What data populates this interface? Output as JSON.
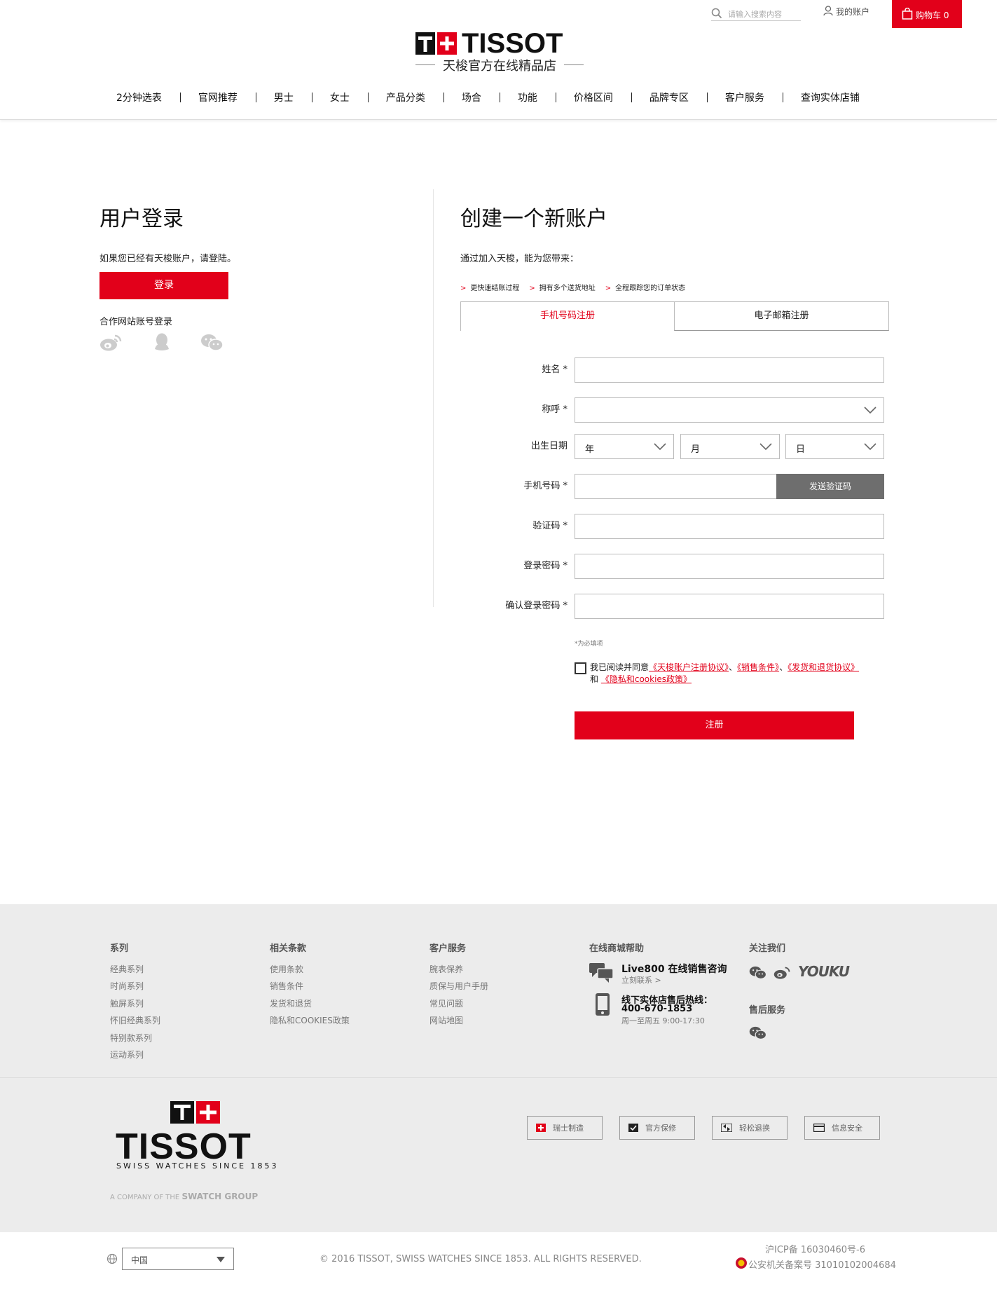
{
  "header": {
    "search_placeholder": "请输入搜索内容",
    "account_label": "我的账户",
    "cart_label": "购物车 0",
    "logo_word": "TISSOT",
    "logo_sub": "天梭官方在线精品店",
    "nav": [
      "2分钟选表",
      "官网推荐",
      "男士",
      "女士",
      "产品分类",
      "场合",
      "功能",
      "价格区间",
      "品牌专区",
      "客户服务",
      "查询实体店铺"
    ]
  },
  "login": {
    "title": "用户登录",
    "desc": "如果您已经有天梭账户，请登陆。",
    "button": "登录",
    "partner_label": "合作网站账号登录",
    "partners": [
      "weibo-icon",
      "qq-icon",
      "wechat-icon"
    ]
  },
  "register": {
    "title": "创建一个新账户",
    "desc": "通过加入天梭，能为您带来：",
    "benefits": [
      "更快速结账过程",
      "拥有多个送货地址",
      "全程跟踪您的订单状态"
    ],
    "tab_phone": "手机号码注册",
    "tab_email": "电子邮箱注册",
    "labels": {
      "name": "姓名 *",
      "salutation": "称呼 *",
      "birthday": "出生日期",
      "phone": "手机号码 *",
      "code": "验证码 *",
      "password": "登录密码 *",
      "confirm": "确认登录密码 *"
    },
    "year": "年",
    "month": "月",
    "day": "日",
    "send_code": "发送验证码",
    "required_note": "*为必填项",
    "agree_prefix": "我已阅读并同意",
    "agree_link1": "《天梭账户注册协议》",
    "agree_link2": "《销售条件》",
    "agree_link3": "《发货和退货协议》",
    "agree_and": "和",
    "agree_link4": "《隐私和cookies政策》",
    "sep": "、",
    "submit": "注册"
  },
  "footer": {
    "col1": {
      "title": "系列",
      "links": [
        "经典系列",
        "时尚系列",
        "触屏系列",
        "怀旧经典系列",
        "特别款系列",
        "运动系列"
      ]
    },
    "col2": {
      "title": "相关条款",
      "links": [
        "使用条款",
        "销售条件",
        "发货和退货",
        "隐私和COOKIES政策"
      ]
    },
    "col3": {
      "title": "客户服务",
      "links": [
        "腕表保养",
        "质保与用户手册",
        "常见问题",
        "网站地图"
      ]
    },
    "col4": {
      "title": "在线商城帮助",
      "live_title": "Live800 在线销售咨询",
      "live_sub": "立刻联系 >",
      "hotline_title": "线下实体店售后热线：",
      "hotline_number": "400-670-1853",
      "hotline_hours": "周一至周五 9:00-17:30"
    },
    "col5": {
      "title": "关注我们",
      "youku": "YOUKU",
      "after_sales": "售后服务"
    },
    "brand_word": "TISSOT",
    "brand_tagline": "SWISS WATCHES SINCE 1853",
    "swatch_line": "A COMPANY OF THE",
    "swatch_brand": "SWATCH GROUP",
    "tags": [
      "瑞士制造",
      "官方保修",
      "轻松退换",
      "信息安全"
    ],
    "region": "中国",
    "copyright": "© 2016 TISSOT, SWISS WATCHES SINCE 1853. ALL RIGHTS RESERVED.",
    "icp": "沪ICP备 16030460号-6",
    "police": "公安机关备案号 31010102004684"
  }
}
